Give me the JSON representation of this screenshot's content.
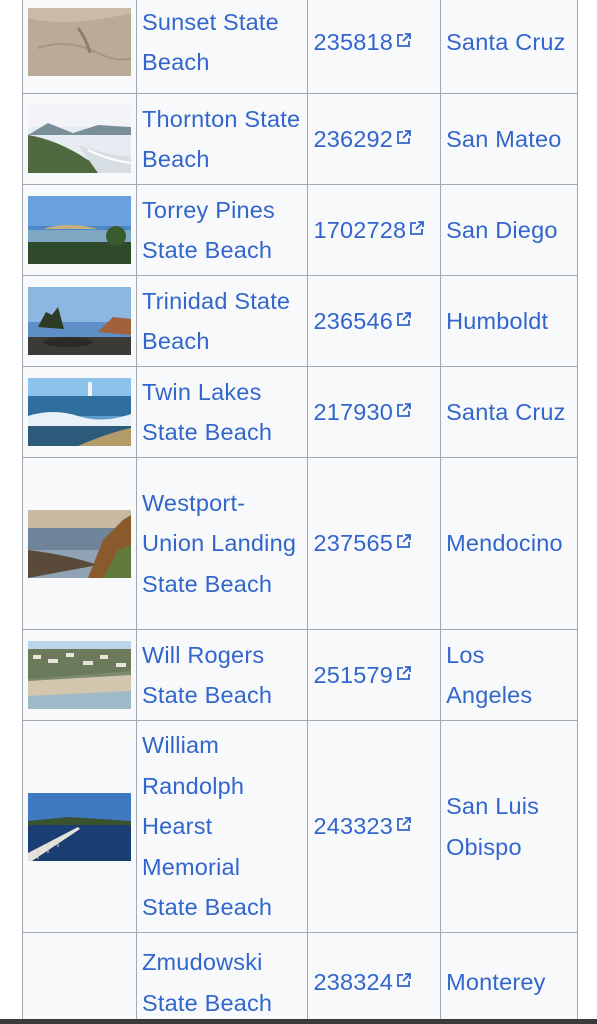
{
  "rows": [
    {
      "image": "sand-dune-photo",
      "name": "Sunset State Beach",
      "id": "235818",
      "county": "Santa Cruz"
    },
    {
      "image": "coastal-cliff-photo",
      "name": "Thornton State Beach",
      "id": "236292",
      "county": "San Mateo"
    },
    {
      "image": "bluff-lagoon-photo",
      "name": "Torrey Pines State Beach",
      "id": "1702728",
      "county": "San Diego"
    },
    {
      "image": "sea-stacks-photo",
      "name": "Trinidad State Beach",
      "id": "236546",
      "county": "Humboldt"
    },
    {
      "image": "lighthouse-waves-photo",
      "name": "Twin Lakes State Beach",
      "id": "217930",
      "county": "Santa Cruz"
    },
    {
      "image": "sunset-coast-photo",
      "name": "Westport-Union Landing State Beach",
      "id": "237565",
      "county": "Mendocino"
    },
    {
      "image": "hillside-homes-photo",
      "name": "Will Rogers State Beach",
      "id": "251579",
      "county": "Los Angeles"
    },
    {
      "image": "pier-bay-photo",
      "name": "William Randolph Hearst Memorial State Beach",
      "id": "243323",
      "county": "San Luis Obispo"
    },
    {
      "image": "",
      "name": "Zmudowski State Beach",
      "id": "238324",
      "county": "Monterey"
    }
  ]
}
